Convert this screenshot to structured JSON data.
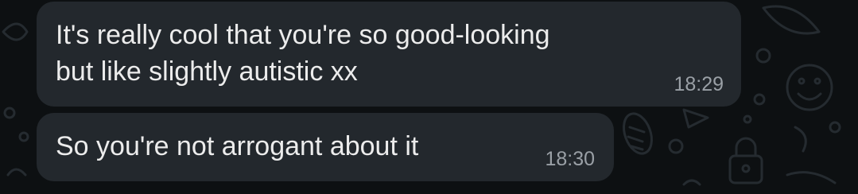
{
  "colors": {
    "background": "#0d1012",
    "bubble": "#23282d",
    "text": "#ececec",
    "timestamp": "#9aa0a6",
    "wallpaper_doodle": "#252b30"
  },
  "messages": [
    {
      "lines": [
        "It's really cool that you're so good-looking",
        "but like slightly autistic xx"
      ],
      "time": "18:29"
    },
    {
      "lines": [
        "So you're not arrogant about it"
      ],
      "time": "18:30"
    }
  ],
  "wallpaper_icons": [
    "smiley-face-icon",
    "corn-icon",
    "padlock-icon",
    "paper-plane-icon",
    "leaf-icon",
    "circle-doodle-icon"
  ]
}
